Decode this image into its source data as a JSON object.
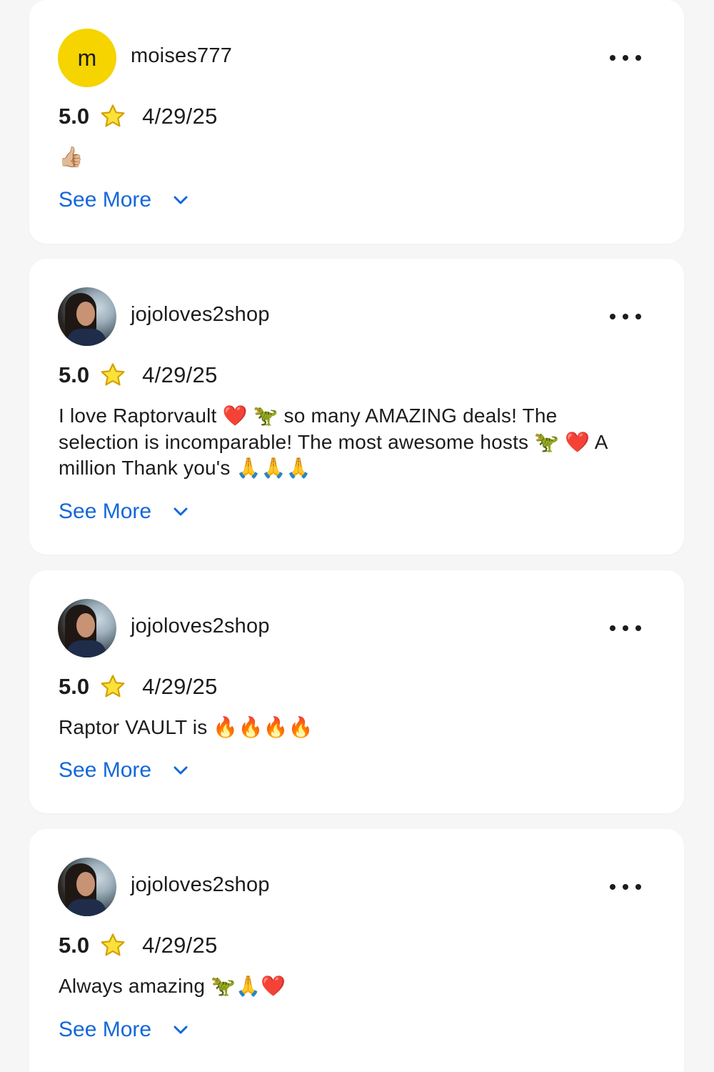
{
  "reviews": [
    {
      "avatar": {
        "type": "letter",
        "letter": "m",
        "color": "#f5d400"
      },
      "username": "moises777",
      "rating": "5.0",
      "date": "4/29/25",
      "text": "👍🏼",
      "see_more_label": "See More"
    },
    {
      "avatar": {
        "type": "photo"
      },
      "username": "jojoloves2shop",
      "rating": "5.0",
      "date": "4/29/25",
      "text": "I love Raptorvault ❤️ 🦖 so many AMAZING deals! The selection is incomparable! The most awesome hosts 🦖 ❤️ A million Thank you's 🙏🙏🙏",
      "see_more_label": "See More"
    },
    {
      "avatar": {
        "type": "photo"
      },
      "username": "jojoloves2shop",
      "rating": "5.0",
      "date": "4/29/25",
      "text": "Raptor VAULT is 🔥🔥🔥🔥",
      "see_more_label": "See More"
    },
    {
      "avatar": {
        "type": "photo"
      },
      "username": "jojoloves2shop",
      "rating": "5.0",
      "date": "4/29/25",
      "text": "Always amazing 🦖🙏❤️",
      "see_more_label": "See More"
    }
  ],
  "colors": {
    "link": "#1467d9",
    "star": "#fbe23a",
    "text": "#1c1c1c",
    "background": "#f6f6f6"
  },
  "icons": {
    "more": "more-horizontal-icon",
    "star": "star-icon",
    "chevron": "chevron-down-icon"
  }
}
